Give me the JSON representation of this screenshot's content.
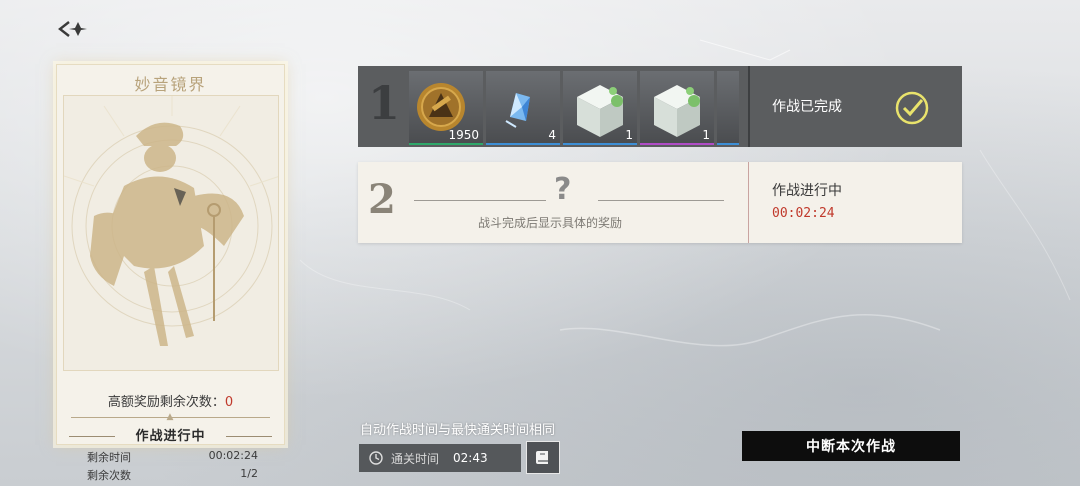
{
  "colors": {
    "accent_red": "#c0392b",
    "check_yellow": "#e9e36c",
    "dark_panel": "#5b5d5f",
    "light_panel": "#f4f1ea"
  },
  "header": {
    "back_icon": "back-arrow-icon"
  },
  "card": {
    "title": "妙音镜界",
    "high_reward_label": "高额奖励剩余次数：",
    "high_reward_count": "0",
    "status": "作战进行中",
    "remaining_time_label": "剩余时间",
    "remaining_time_value": "00:02:24",
    "remaining_count_label": "剩余次数",
    "remaining_count_value": "1/2"
  },
  "battle1": {
    "number": "1",
    "status": "作战已完成",
    "check_icon": "check-circle-icon",
    "rewards": [
      {
        "name": "coin-item",
        "count": "1950",
        "bar_color": "#2fa86a"
      },
      {
        "name": "crystal-item",
        "count": "4",
        "bar_color": "#3d8fd6"
      },
      {
        "name": "cube-item",
        "count": "1",
        "bar_color": "#3d8fd6"
      },
      {
        "name": "cube-item",
        "count": "1",
        "bar_color": "#b04cc6"
      }
    ]
  },
  "battle2": {
    "number": "2",
    "placeholder": "?",
    "hint": "战斗完成后显示具体的奖励",
    "status": "作战进行中",
    "timer": "00:02:24"
  },
  "bottom": {
    "auto_note": "自动作战时间与最快通关时间相同",
    "clear_time_label": "通关时间",
    "clear_time_value": "02:43",
    "clock_icon": "clock-icon",
    "book_icon": "book-icon",
    "stop_button": "中断本次作战"
  }
}
